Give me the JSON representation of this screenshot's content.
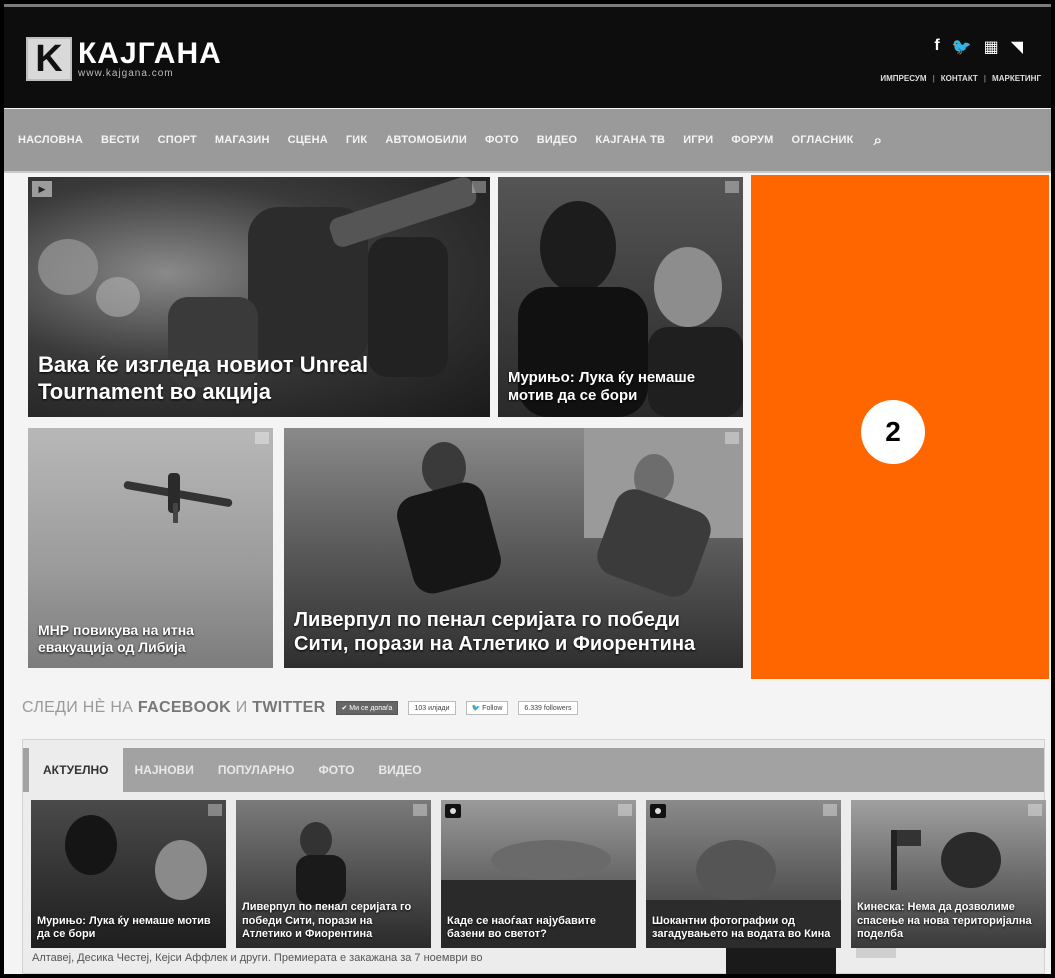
{
  "header": {
    "logo_letter": "K",
    "logo_name": "КАЈГАНА",
    "logo_url": "www.kajgana.com",
    "social_icons": [
      "facebook-icon",
      "twitter-icon",
      "youtube-icon",
      "rss-icon"
    ],
    "social_glyphs": {
      "facebook": "f",
      "twitter": "🐦",
      "youtube": "▦",
      "rss": "◥"
    },
    "top_links": [
      "ИМПРЕСУМ",
      "КОНТАКТ",
      "МАРКЕТИНГ"
    ]
  },
  "nav": {
    "items": [
      "НАСЛОВНА",
      "ВЕСТИ",
      "СПОРТ",
      "МАГАЗИН",
      "СЦЕНА",
      "ГИК",
      "АВТОМОБИЛИ",
      "ФОТО",
      "ВИДЕО",
      "КАЈГАНА ТВ",
      "ИГРИ",
      "ФОРУМ",
      "ОГЛАСНИК"
    ],
    "search_icon": "search-icon",
    "search_glyph": "⌕"
  },
  "featured": {
    "tile1": {
      "caption": "Вака ќе изгледа новиот Unreal Tournament во акција",
      "badge": "video"
    },
    "tile2": {
      "caption": "Мурињо: Лука ќу немаше мотив да се бори"
    },
    "tile3": {
      "caption": "МНР повикува на итна евакуација од Либија"
    },
    "tile4": {
      "caption": "Ливерпул по пенал серијата го победи Сити, порази на Атлетико и Фиорентина"
    }
  },
  "ad": {
    "label": "2",
    "color": "#ff6600"
  },
  "follow": {
    "text_pre": "СЛЕДИ НЀ НА ",
    "facebook": "FACEBOOK",
    "and": " И ",
    "twitter": "TWITTER",
    "like_btn": "✔ Ми се допаѓа",
    "like_count": "103 илјади",
    "follow_btn": "🐦 Follow",
    "followers": "6.339 followers"
  },
  "tabs": {
    "items": [
      "АКТУЕЛНО",
      "НАЈНОВИ",
      "ПОПУЛАРНО",
      "ФОТО",
      "ВИДЕО"
    ],
    "active_index": 0
  },
  "thumbs": [
    {
      "caption": "Мурињо: Лука ќу немаше мотив да се бори",
      "badge": ""
    },
    {
      "caption": "Ливерпул по пенал серијата го победи Сити, порази на Атлетико и Фиорентина",
      "badge": ""
    },
    {
      "caption": "Каде се наоѓаат најубавите базени во светот?",
      "badge": "camera"
    },
    {
      "caption": "Шокантни фотографии од загадувањето на водата во Кина",
      "badge": "camera"
    },
    {
      "caption": "Кинеска: Нема да дозволиме спасење на нова територијална поделба",
      "badge": ""
    }
  ],
  "bottom": {
    "text": "Алтавеј, Десика Честеј, Кејси Аффлек и други. Премиерата е закажана за 7 ноември во"
  }
}
